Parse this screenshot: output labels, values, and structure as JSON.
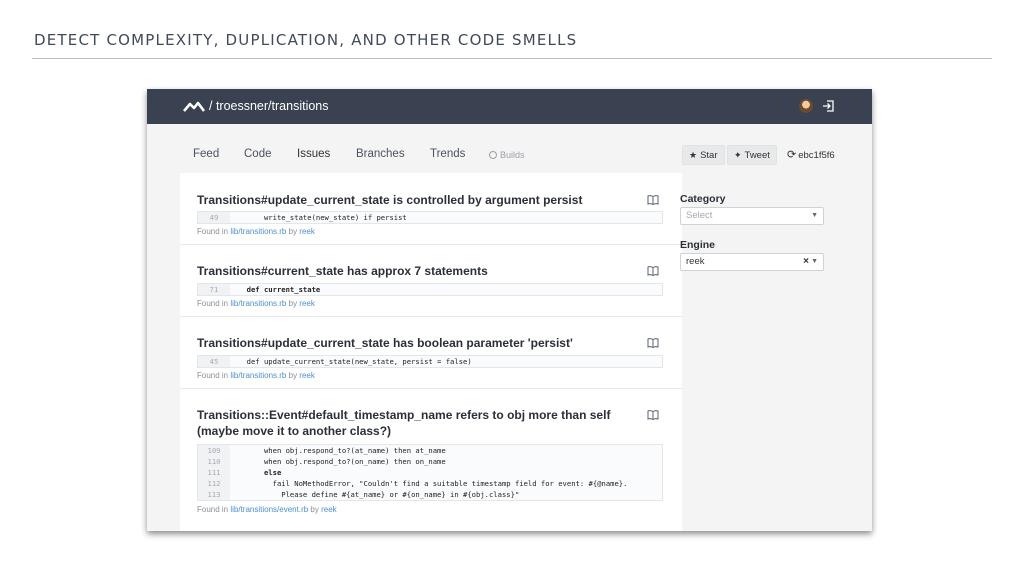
{
  "slide": {
    "title": "DETECT COMPLEXITY, DUPLICATION, AND OTHER CODE SMELLS"
  },
  "topbar": {
    "repo_path": "/ troessner/transitions"
  },
  "nav": {
    "tabs": [
      {
        "label": "Feed"
      },
      {
        "label": "Code"
      },
      {
        "label": "Issues"
      },
      {
        "label": "Branches"
      },
      {
        "label": "Trends"
      }
    ],
    "builds_label": "Builds",
    "star_label": "Star",
    "tweet_label": "Tweet",
    "commit": "ebc1f5f6"
  },
  "issues": [
    {
      "title": "Transitions#update_current_state is controlled by argument persist",
      "code": [
        {
          "ln": "49",
          "text": "      write_state(new_state) if persist"
        }
      ],
      "found_prefix": "Found in ",
      "file": "lib/transitions.rb",
      "by_text": " by ",
      "engine": "reek"
    },
    {
      "title": "Transitions#current_state has approx 7 statements",
      "code": [
        {
          "ln": "71",
          "text": "  def current_state"
        }
      ],
      "found_prefix": "Found in ",
      "file": "lib/transitions.rb",
      "by_text": " by ",
      "engine": "reek"
    },
    {
      "title": "Transitions#update_current_state has boolean parameter 'persist'",
      "code": [
        {
          "ln": "45",
          "text": "  def update_current_state(new_state, persist = false)"
        }
      ],
      "found_prefix": "Found in ",
      "file": "lib/transitions.rb",
      "by_text": " by ",
      "engine": "reek"
    },
    {
      "title": "Transitions::Event#default_timestamp_name refers to obj more than self (maybe move it to another class?)",
      "code": [
        {
          "ln": "109",
          "text": "      when obj.respond_to?(at_name) then at_name"
        },
        {
          "ln": "110",
          "text": "      when obj.respond_to?(on_name) then on_name"
        },
        {
          "ln": "111",
          "text": "      else"
        },
        {
          "ln": "112",
          "text": "        fail NoMethodError, \"Couldn't find a suitable timestamp field for event: #{@name}."
        },
        {
          "ln": "113",
          "text": "          Please define #{at_name} or #{on_name} in #{obj.class}\""
        }
      ],
      "found_prefix": "Found in ",
      "file": "lib/transitions/event.rb",
      "by_text": " by ",
      "engine": "reek"
    }
  ],
  "sidebar": {
    "category_label": "Category",
    "category_placeholder": "Select",
    "engine_label": "Engine",
    "engine_value": "reek",
    "clear_glyph": "×"
  }
}
